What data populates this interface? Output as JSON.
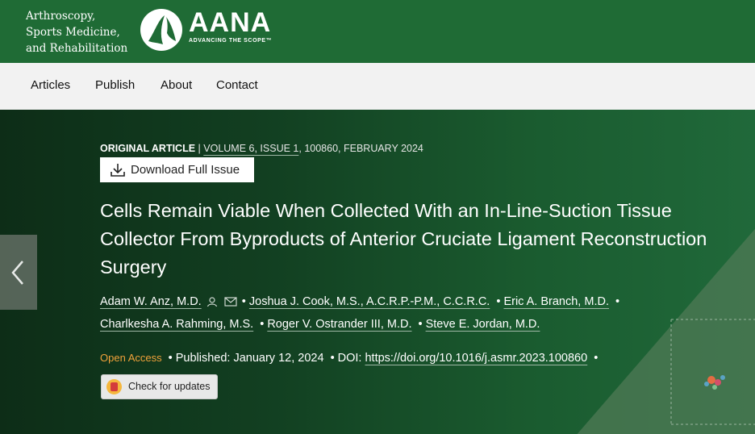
{
  "journal": {
    "name_lines": [
      "Arthroscopy,",
      "Sports Medicine,",
      "and Rehabilitation"
    ],
    "society": "AANA",
    "society_tagline": "ADVANCING THE SCOPE™",
    "logo_icon": "aana-logo-icon"
  },
  "nav": {
    "items": [
      "Articles",
      "Publish",
      "About",
      "Contact"
    ]
  },
  "article": {
    "type": "ORIGINAL ARTICLE",
    "divider": " | ",
    "volume": "VOLUME 6, ISSUE 1",
    "citation_rest": ", 100860, FEBRUARY 2024",
    "download_label": "Download Full Issue",
    "title": "Cells Remain Viable When Collected With an In-Line-Suction Tissue Collector From Byproducts of Anterior Cruciate Ligament Reconstruction Surgery",
    "authors": [
      "Adam W. Anz, M.D.",
      "Joshua J. Cook, M.S., A.C.R.P.-P.M., C.C.R.C.",
      "Eric A. Branch, M.D.",
      "Charlkesha A. Rahming, M.S.",
      "Roger V. Ostrander III, M.D.",
      "Steve E. Jordan, M.D."
    ],
    "bullet": "•",
    "open_access": "Open Access",
    "published": "Published: January 12, 2024",
    "doi_label": "DOI: ",
    "doi_link": "https://doi.org/10.1016/j.asmr.2023.100860",
    "check_updates": "Check for updates"
  },
  "colors": {
    "header_green": "#1f6b35",
    "nav_bg": "#f2f2f2",
    "open_access": "#f0a13a"
  }
}
